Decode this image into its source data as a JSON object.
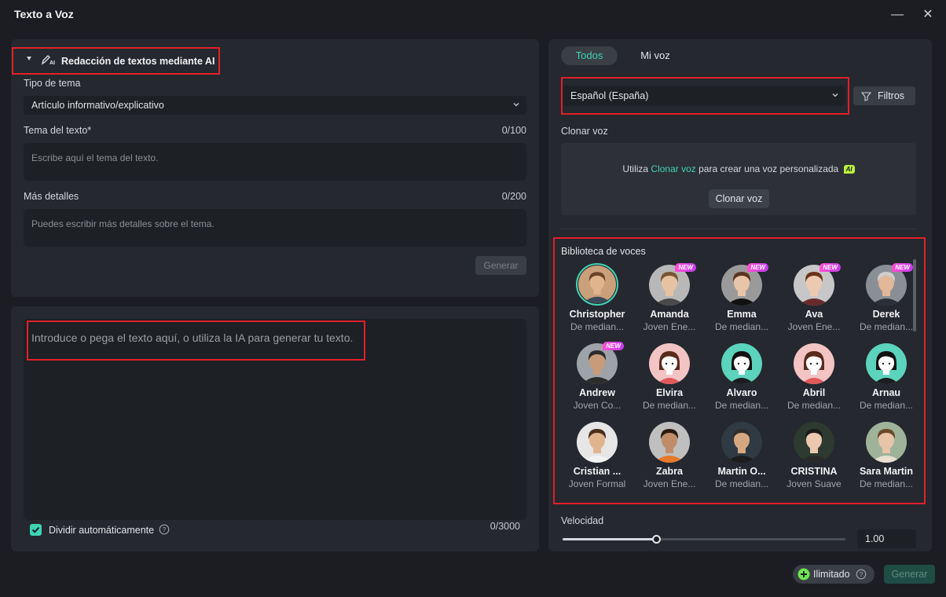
{
  "window": {
    "title": "Texto a Voz",
    "minimize_glyph": "—",
    "close_glyph": "✕"
  },
  "ai_writer": {
    "header": "Redacción de textos mediante AI",
    "topic_type_label": "Tipo de tema",
    "topic_type_value": "Artículo informativo/explicativo",
    "topic_label": "Tema del texto*",
    "topic_counter": "0/100",
    "topic_placeholder": "Escribe aquí el tema del texto.",
    "details_label": "Más detalles",
    "details_counter": "0/200",
    "details_placeholder": "Puedes escribir más detalles sobre el tema.",
    "generate_label": "Generar"
  },
  "text_editor": {
    "placeholder": "Introduce o pega el texto aquí, o utiliza la IA para generar tu texto.",
    "auto_split_label": "Dividir automáticamente",
    "counter": "0/3000"
  },
  "voice_panel": {
    "tabs": [
      "Todos",
      "Mi voz"
    ],
    "language": "Español (España)",
    "filters_label": "Filtros",
    "clone_title": "Clonar voz",
    "clone_text_before": "Utiliza ",
    "clone_link": "Clonar voz",
    "clone_text_after": " para crear una voz personalizada",
    "ai_badge": "AI",
    "clone_button": "Clonar voz",
    "library_title": "Biblioteca de voces",
    "new_badge": "NEW",
    "voices": [
      {
        "name": "Christopher",
        "desc": "De median...",
        "new": false
      },
      {
        "name": "Amanda",
        "desc": "Joven Ene...",
        "new": true
      },
      {
        "name": "Emma",
        "desc": "De median...",
        "new": true
      },
      {
        "name": "Ava",
        "desc": "Joven Ene...",
        "new": true
      },
      {
        "name": "Derek",
        "desc": "De median...",
        "new": true
      },
      {
        "name": "Andrew",
        "desc": "Joven Co...",
        "new": true
      },
      {
        "name": "Elvira",
        "desc": "De median...",
        "new": false
      },
      {
        "name": "Alvaro",
        "desc": "De median...",
        "new": false
      },
      {
        "name": "Abril",
        "desc": "De median...",
        "new": false
      },
      {
        "name": "Arnau",
        "desc": "De median...",
        "new": false
      },
      {
        "name": "Cristian ...",
        "desc": "Joven Formal",
        "new": false
      },
      {
        "name": "Zabra",
        "desc": "Joven Ene...",
        "new": false
      },
      {
        "name": "Martin O...",
        "desc": "De median...",
        "new": false
      },
      {
        "name": "CRISTINA",
        "desc": "Joven Suave",
        "new": false
      },
      {
        "name": "Sara Martin",
        "desc": "De median...",
        "new": false
      }
    ],
    "speed_label": "Velocidad",
    "speed_value": "1.00",
    "speed_fraction": 0.33
  },
  "footer": {
    "unlimited_label": "Ilimitado",
    "generate_label": "Generar"
  },
  "colors": {
    "accent": "#3fd3b5",
    "highlight": "#e0202a",
    "panel": "#25282e"
  }
}
